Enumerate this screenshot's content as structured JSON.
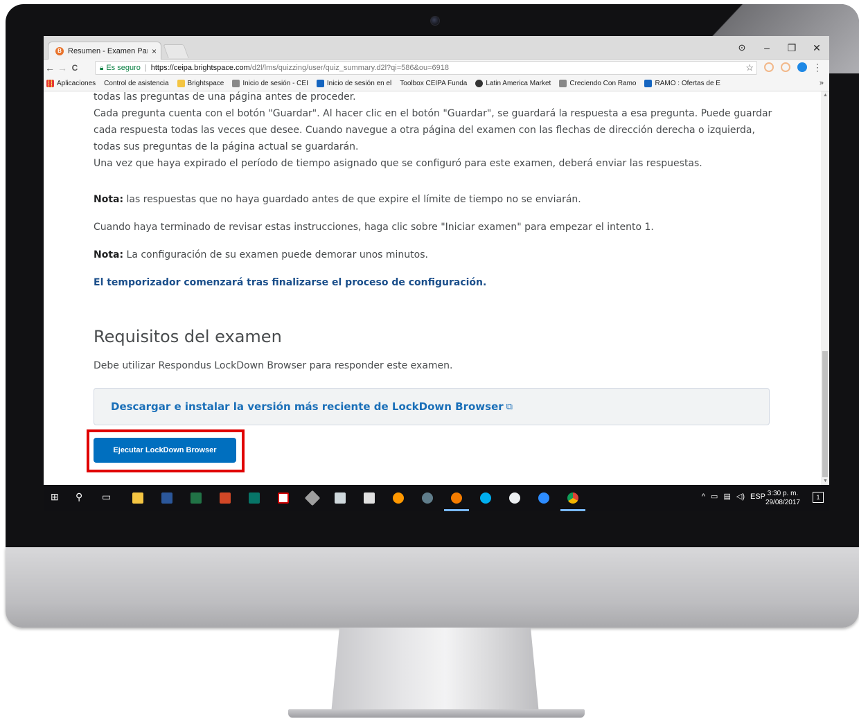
{
  "browser": {
    "tab_title": "Resumen - Examen Parci",
    "tab_close": "×",
    "window_minimize": "–",
    "window_restore": "❐",
    "window_close": "✕",
    "profile_icon": "profile-icon",
    "nav": {
      "back": "←",
      "forward": "→",
      "reload": "C"
    },
    "address": {
      "secure_label": "Es seguro",
      "url_host": "https://ceipa.brightspace.com",
      "url_path": "/d2l/lms/quizzing/user/quiz_summary.d2l?qi=586&ou=6918"
    },
    "bookmarks": [
      {
        "label": "Aplicaciones",
        "icon": "apps"
      },
      {
        "label": "Control de asistencia",
        "icon": "page"
      },
      {
        "label": "Brightspace",
        "icon": "folder"
      },
      {
        "label": "Inicio de sesión - CEI",
        "icon": "grey"
      },
      {
        "label": "Inicio de sesión en el",
        "icon": "blue"
      },
      {
        "label": "Toolbox CEIPA Funda",
        "icon": "page"
      },
      {
        "label": "Latin America Market",
        "icon": "dark"
      },
      {
        "label": "Creciendo Con Ramo",
        "icon": "grey"
      },
      {
        "label": "RAMO : Ofertas de E",
        "icon": "blue"
      }
    ],
    "bookmarks_more": "»"
  },
  "content": {
    "para_top": "todas las preguntas de una página antes de proceder.",
    "para_save": "Cada pregunta cuenta con el botón \"Guardar\". Al hacer clic en el botón \"Guardar\", se guardará la respuesta a esa pregunta. Puede guardar cada respuesta todas las veces que desee. Cuando navegue a otra página del examen con las flechas de dirección derecha o izquierda, todas sus preguntas de la página actual se guardarán.",
    "para_expired": "Una vez que haya expirado el período de tiempo asignado que se configuró para este examen, deberá enviar las respuestas.",
    "note1_label": "Nota:",
    "note1_text": " las respuestas que no haya guardado antes de que expire el límite de tiempo no se enviarán.",
    "para_start": "Cuando haya terminado de revisar estas instrucciones, haga clic sobre \"Iniciar examen\" para empezar el intento 1.",
    "note2_label": "Nota:",
    "note2_text": " La configuración de su examen puede demorar unos minutos.",
    "timer_note": "El temporizador comenzará tras finalizarse el proceso de configuración.",
    "requirements_title": "Requisitos del examen",
    "requirements_text": "Debe utilizar Respondus LockDown Browser para responder este examen.",
    "download_link": "Descargar e instalar la versión más reciente de LockDown Browser",
    "launch_button": "Ejecutar LockDown Browser"
  },
  "taskbar": {
    "language": "ESP",
    "time": "3:30 p. m.",
    "date": "29/08/2017",
    "notifications": "1"
  },
  "colors": {
    "highlight": "#e00000",
    "primary_button": "#006fbf",
    "link": "#1a6fb8"
  }
}
